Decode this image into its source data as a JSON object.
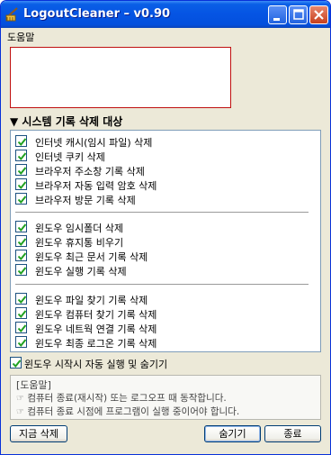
{
  "window": {
    "title": "LogoutCleaner – v0.90",
    "icon": "broom-app-icon",
    "controls": {
      "minimize": "minimize-icon",
      "maximize": "maximize-icon",
      "close": "close-icon"
    }
  },
  "menu": {
    "help_label": "도움말"
  },
  "section": {
    "title": "▼ 시스템 기록 삭제 대상"
  },
  "groups": [
    {
      "items": [
        {
          "label": "인터넷 캐시(임시 파일) 삭제",
          "checked": true
        },
        {
          "label": "인터넷 쿠키 삭제",
          "checked": true
        },
        {
          "label": "브라우저 주소창 기록 삭제",
          "checked": true
        },
        {
          "label": "브라우저 자동 입력 암호 삭제",
          "checked": true
        },
        {
          "label": "브라우저 방문 기록 삭제",
          "checked": true
        }
      ]
    },
    {
      "items": [
        {
          "label": "윈도우 임시폴더 삭제",
          "checked": true
        },
        {
          "label": "윈도우 휴지통 비우기",
          "checked": true
        },
        {
          "label": "윈도우 최근 문서 기록 삭제",
          "checked": true
        },
        {
          "label": "윈도우 실행 기록 삭제",
          "checked": true
        }
      ]
    },
    {
      "items": [
        {
          "label": "윈도우 파일 찾기 기록 삭제",
          "checked": true
        },
        {
          "label": "윈도우 컴퓨터 찾기 기록 삭제",
          "checked": true
        },
        {
          "label": "윈도우 네트웍 연결 기록 삭제",
          "checked": true
        },
        {
          "label": "윈도우 최종 로그온 기록 삭제",
          "checked": true
        }
      ]
    }
  ],
  "startup_option": {
    "label": "윈도우 시작시 자동 실행 및 숨기기",
    "checked": true
  },
  "help": {
    "title": "[도움말]",
    "lines": [
      {
        "icon": "hand-pointer-icon",
        "glyph": "☞",
        "text": "컴퓨터 종료(재시작) 또는 로그오프 때 동작합니다."
      },
      {
        "icon": "hand-pointer-icon",
        "glyph": "☞",
        "text": "컴퓨터 종료 시점에 프로그램이 실행 중이어야 합니다."
      }
    ]
  },
  "buttons": {
    "delete_now": "지금 삭제",
    "hide": "숨기기",
    "exit": "종료"
  },
  "colors": {
    "titlebar": "#0554e3",
    "window_bg": "#ece9d8",
    "check": "#21a121",
    "banner_border": "#c01010"
  }
}
